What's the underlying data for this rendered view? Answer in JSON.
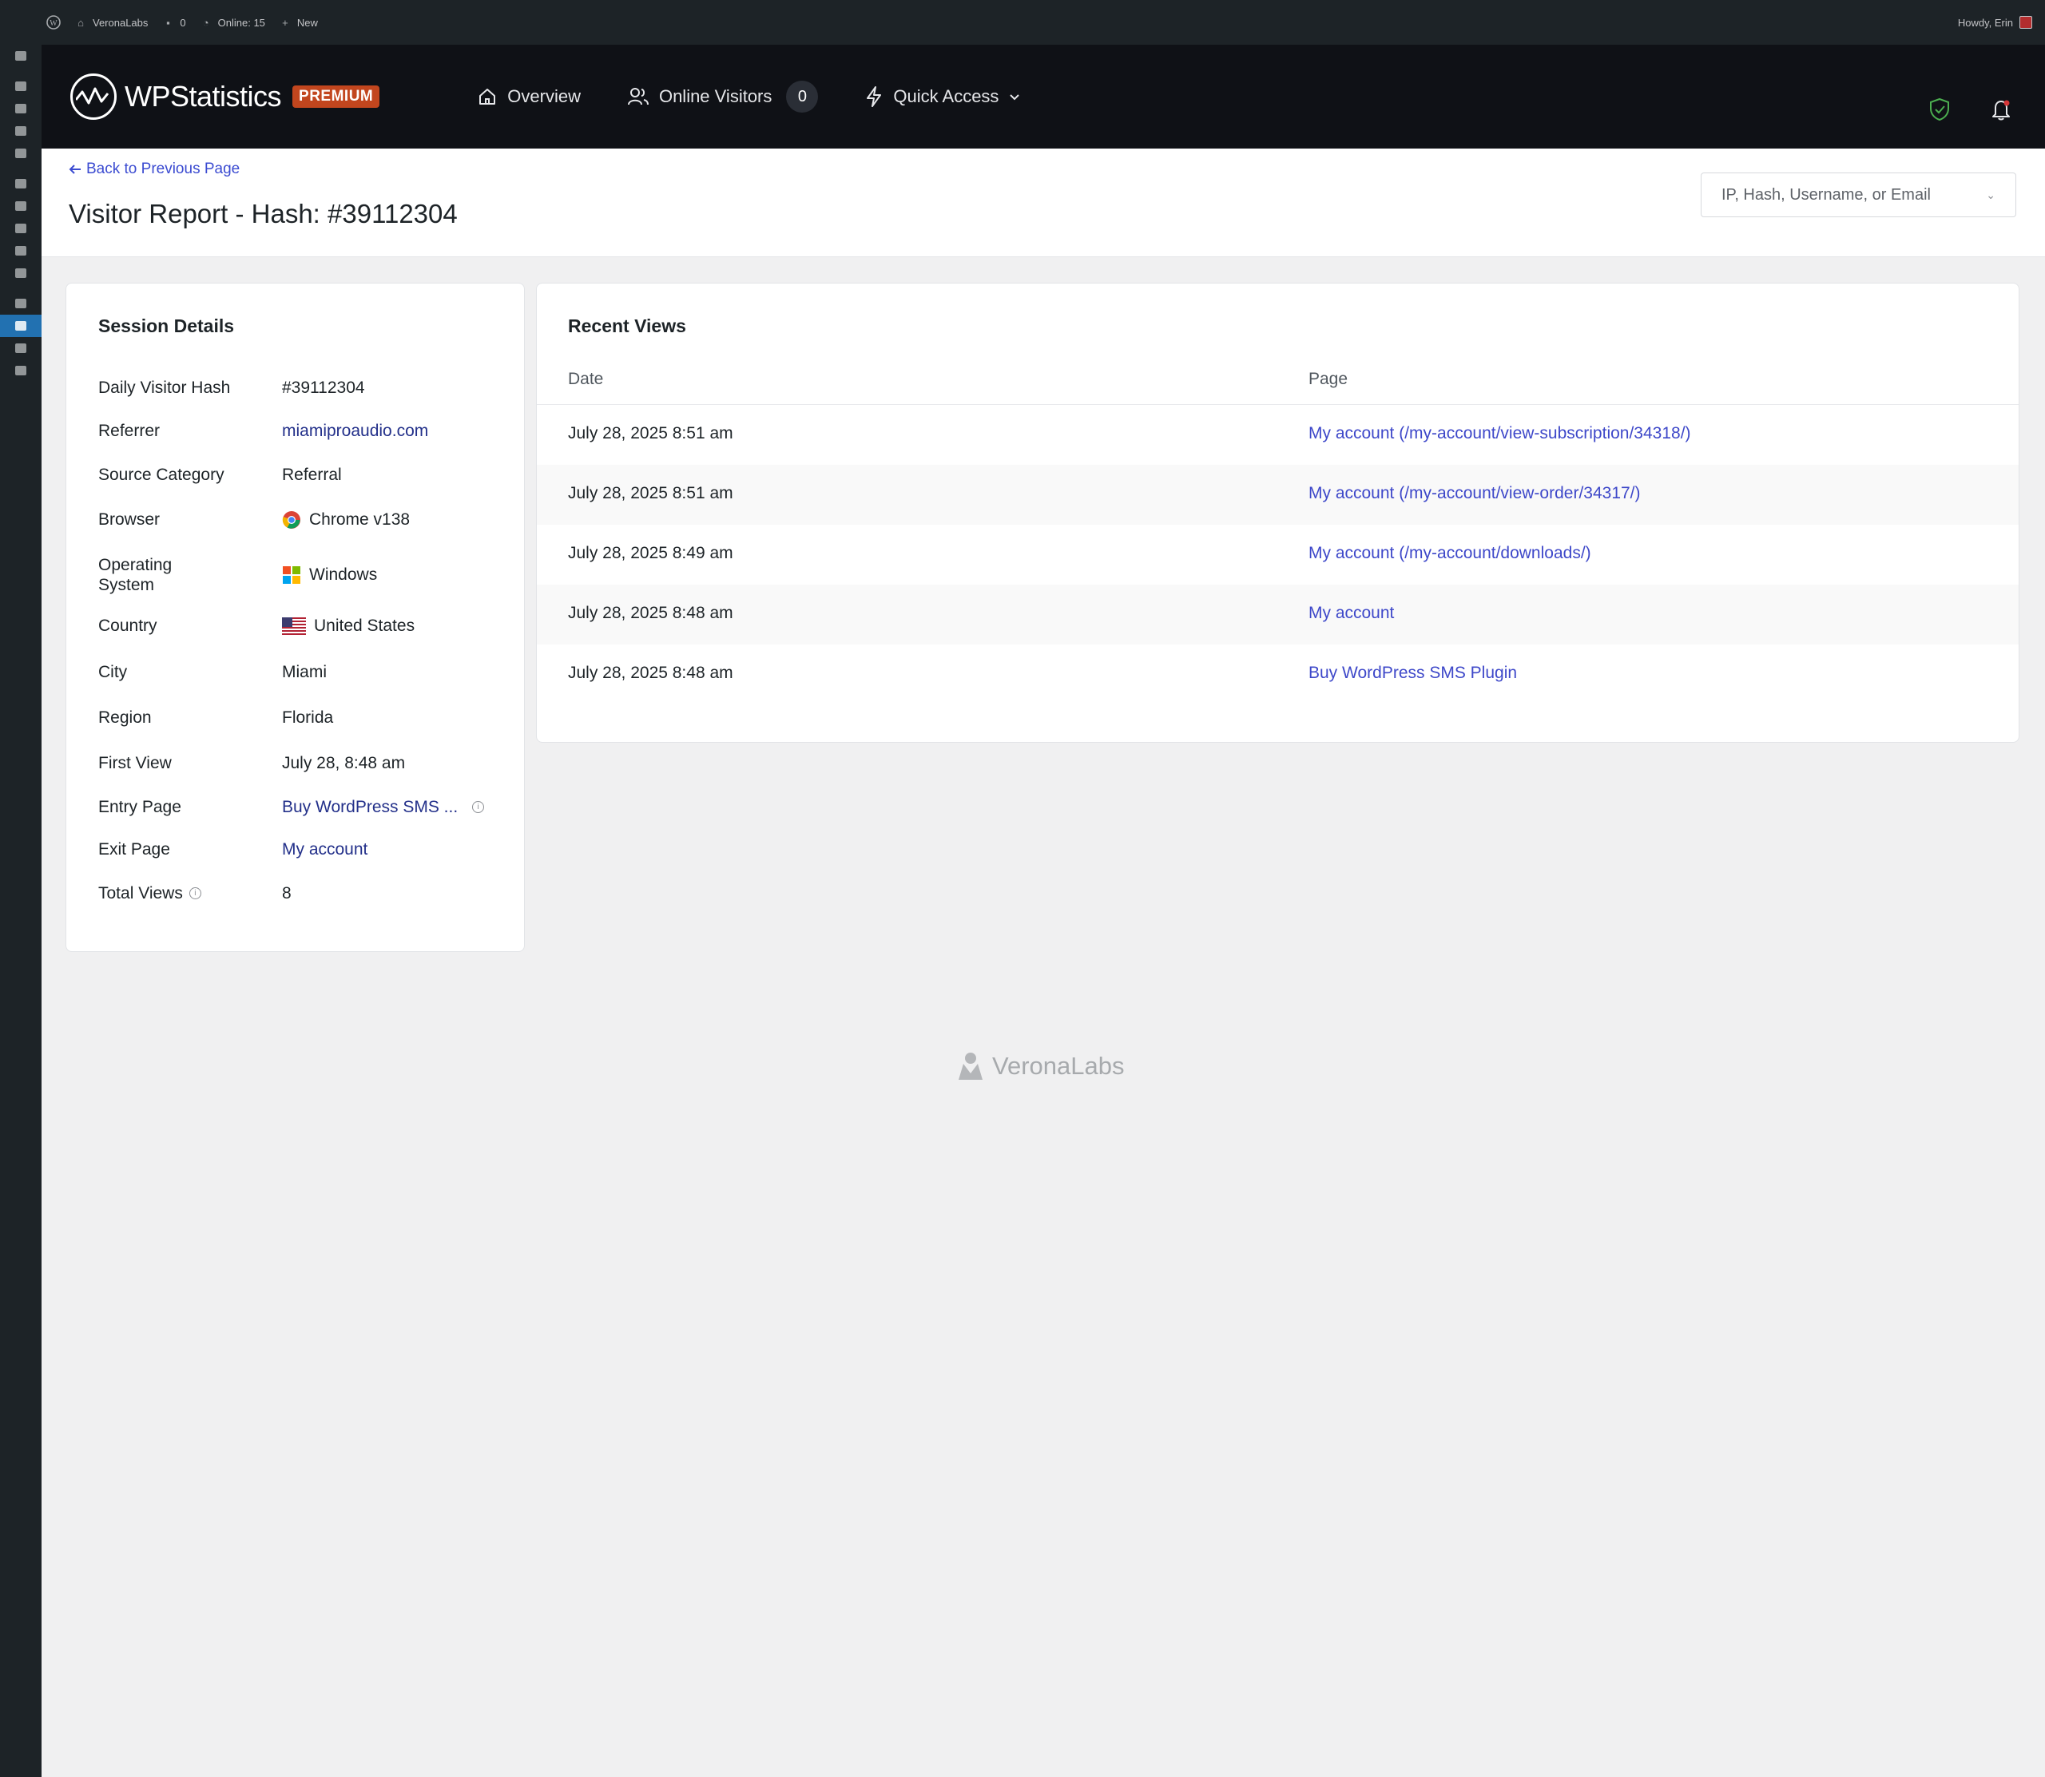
{
  "admin_bar": {
    "site_name": "VeronaLabs",
    "comments_count": "0",
    "online_label": "Online: 15",
    "new_label": "New",
    "howdy": "Howdy, Erin"
  },
  "header": {
    "logo_text": "WPStatistics",
    "premium_badge": "PREMIUM",
    "nav": {
      "overview": "Overview",
      "online_visitors": "Online Visitors",
      "online_count": "0",
      "quick_access": "Quick Access"
    }
  },
  "titlebar": {
    "back_link": "Back to Previous Page",
    "title": "Visitor Report - Hash: #39112304",
    "search_placeholder": "IP, Hash, Username, or Email"
  },
  "session": {
    "title": "Session Details",
    "rows": [
      {
        "label": "Daily Visitor Hash",
        "value": "#39112304"
      },
      {
        "label": "Referrer",
        "value": "miamiproaudio.com"
      },
      {
        "label": "Source Category",
        "value": "Referral"
      },
      {
        "label": "Browser",
        "value": "Chrome v138",
        "icon": "chrome-icon"
      },
      {
        "label": "Operating System",
        "value": "Windows",
        "icon": "windows-icon"
      },
      {
        "label": "Country",
        "value": "United States",
        "icon": "us-flag-icon"
      },
      {
        "label": "City",
        "value": "Miami"
      },
      {
        "label": "Region",
        "value": "Florida"
      },
      {
        "label": "First View",
        "value": "July 28, 8:48 am"
      },
      {
        "label": "Entry Page",
        "value": "Buy WordPress SMS ..."
      },
      {
        "label": "Exit Page",
        "value": "My account"
      },
      {
        "label": "Total Views",
        "value": "8"
      }
    ]
  },
  "recent": {
    "title": "Recent Views",
    "col_date": "Date",
    "col_page": "Page",
    "rows": [
      {
        "date": "July 28, 2025 8:51 am",
        "page": "My account (/my-account/view-subscription/34318/)"
      },
      {
        "date": "July 28, 2025 8:51 am",
        "page": "My account (/my-account/view-order/34317/)"
      },
      {
        "date": "July 28, 2025 8:49 am",
        "page": "My account (/my-account/downloads/)"
      },
      {
        "date": "July 28, 2025 8:48 am",
        "page": "My account"
      },
      {
        "date": "July 28, 2025 8:48 am",
        "page": "Buy WordPress SMS Plugin"
      }
    ]
  },
  "footer": {
    "brand": "VeronaLabs"
  },
  "colors": {
    "accent": "#3e48c9",
    "premium": "#c2461e",
    "header_bg": "#0f1116",
    "admin_bg": "#1d2327"
  }
}
